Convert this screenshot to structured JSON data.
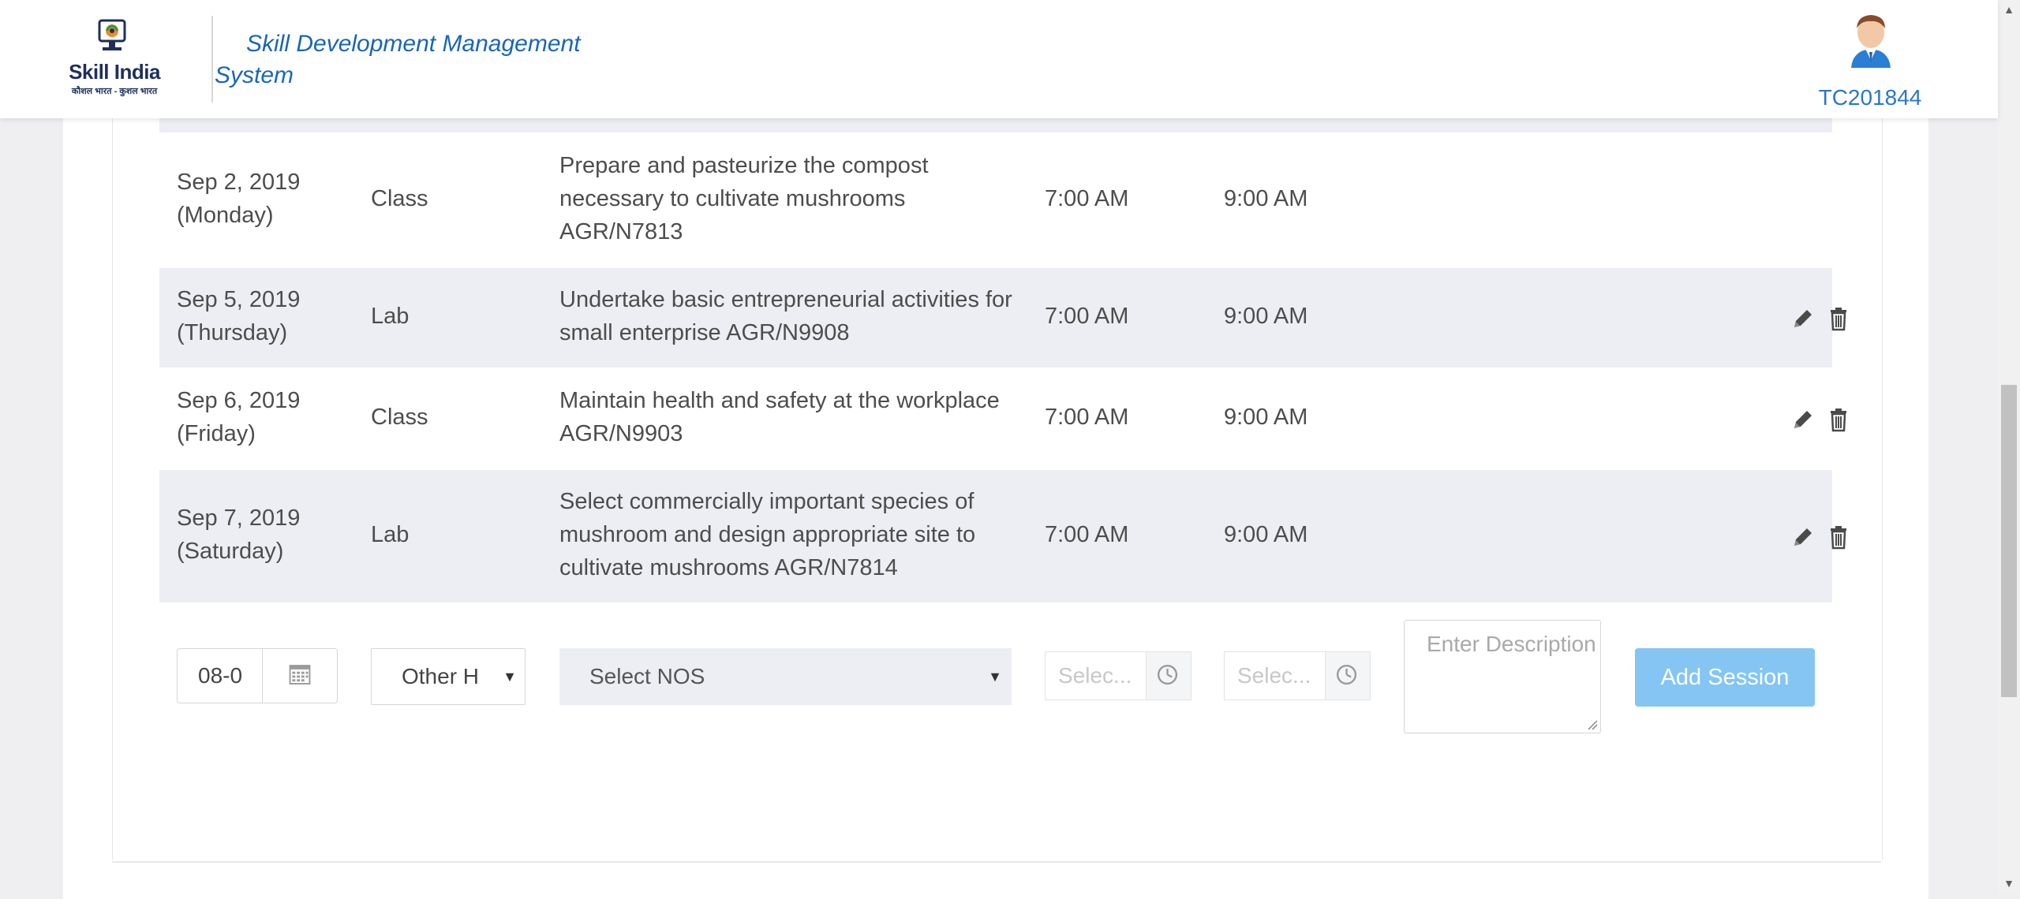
{
  "header": {
    "logo_title": "Skill India",
    "logo_subtitle": "कौशल भारत - कुशल भारत",
    "app_title": "Skill Development Management System",
    "user_id": "TC201844"
  },
  "sessions": [
    {
      "date": "Sep 2, 2019",
      "day": "(Monday)",
      "type": "Class",
      "nos": "Prepare and pasteurize the compost necessary to cultivate mushrooms AGR/N7813",
      "start": "7:00 AM",
      "end": "9:00 AM",
      "actions": false
    },
    {
      "date": "Sep 5, 2019",
      "day": "(Thursday)",
      "type": "Lab",
      "nos": "Undertake basic entrepreneurial activities for small enterprise AGR/N9908",
      "start": "7:00 AM",
      "end": "9:00 AM",
      "actions": true
    },
    {
      "date": "Sep 6, 2019",
      "day": "(Friday)",
      "type": "Class",
      "nos": "Maintain health and safety at the workplace AGR/N9903",
      "start": "7:00 AM",
      "end": "9:00 AM",
      "actions": true
    },
    {
      "date": "Sep 7, 2019",
      "day": "(Saturday)",
      "type": "Lab",
      "nos": "Select commercially important species of mushroom and design appropriate site to cultivate mushrooms AGR/N7814",
      "start": "7:00 AM",
      "end": "9:00 AM",
      "actions": true
    }
  ],
  "form": {
    "date_value": "08-0",
    "type_value": "Other H",
    "nos_placeholder": "Select NOS",
    "start_placeholder": "Selec...",
    "end_placeholder": "Selec...",
    "description_placeholder": "Enter Description",
    "add_button": "Add Session"
  },
  "colors": {
    "brand_blue": "#1a66b5",
    "row_shade": "#eceef3",
    "add_button": "#84c5f4"
  },
  "icons": {
    "edit": "pencil-icon",
    "delete": "trash-icon",
    "calendar": "calendar-icon",
    "clock": "clock-icon"
  }
}
